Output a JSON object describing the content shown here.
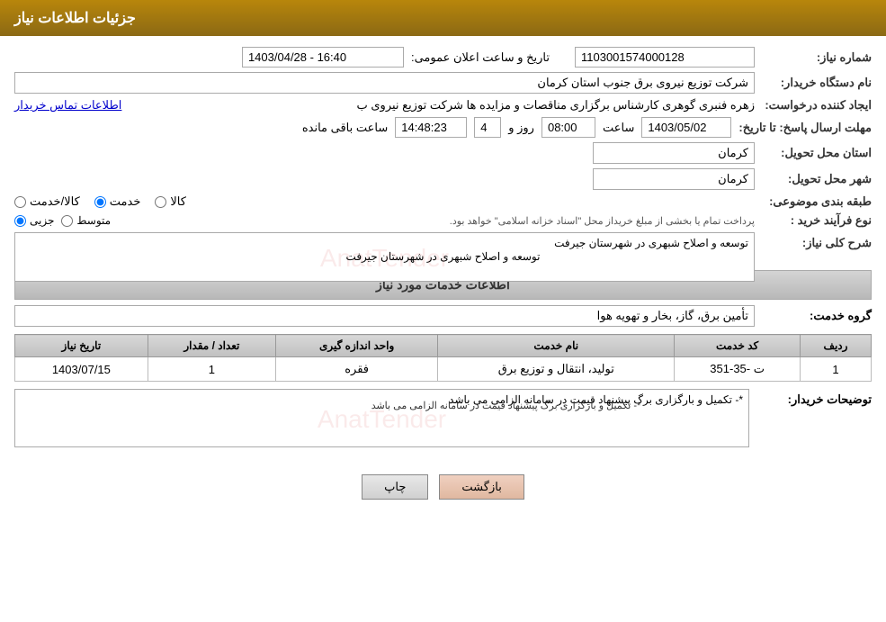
{
  "header": {
    "title": "جزئیات اطلاعات نیاز"
  },
  "fields": {
    "shomareNiaz_label": "شماره نیاز:",
    "shomareNiaz_value": "1103001574000128",
    "namDastgah_label": "نام دستگاه خریدار:",
    "namDastgah_value": "شرکت توزیع نیروی برق جنوب استان کرمان",
    "tarikhoSaat_label": "تاریخ و ساعت اعلان عمومی:",
    "tarikhoSaat_value": "1403/04/28 - 16:40",
    "ijadKonande_label": "ایجاد کننده درخواست:",
    "ijadKonande_value": "زهره فنبری گوهری کارشناس برگزاری مناقصات و مزایده ها شرکت توزیع نیروی ب",
    "ijadKonande_link": "اطلاعات تماس خریدار",
    "mohlatErsalPasokh_label": "مهلت ارسال پاسخ: تا تاریخ:",
    "mohlatDate": "1403/05/02",
    "mohlatSaat_label": "ساعت",
    "mohlatSaat": "08:00",
    "mohlatRooz_label": "روز و",
    "mohlatRooz": "4",
    "mohlatManande_label": "ساعت باقی مانده",
    "mohlatManande": "14:48:23",
    "ostan_label": "استان محل تحویل:",
    "ostan_value": "کرمان",
    "shahr_label": "شهر محل تحویل:",
    "shahr_value": "کرمان",
    "tabaghe_label": "طبقه بندی موضوعی:",
    "tabaghe_kala": "کالا",
    "tabaghe_khadamat": "خدمت",
    "tabaghe_kala_khadamat": "کالا/خدمت",
    "tabaghe_selected": "khadamat",
    "noeFarayand_label": "نوع فرآیند خرید :",
    "noeFarayand_jozvi": "جزیی",
    "noeFarayand_motevaset": "متوسط",
    "noeFarayand_text": "پرداخت تمام یا بخشی از مبلغ خریداز محل \"اسناد خزانه اسلامی\" خواهد بود.",
    "noeFarayand_selected": "jozvi",
    "sharh_label": "شرح کلی نیاز:",
    "sharh_value": "توسعه و اصلاح شبهری در شهرستان جیرفت",
    "service_section_title": "اطلاعات خدمات مورد نیاز",
    "groheKhadamat_label": "گروه خدمت:",
    "groheKhadamat_value": "تأمین برق، گاز، بخار و تهویه هوا",
    "table_headers": [
      "ردیف",
      "کد خدمت",
      "نام خدمت",
      "واحد اندازه گیری",
      "تعداد / مقدار",
      "تاریخ نیاز"
    ],
    "table_rows": [
      {
        "radif": "1",
        "kodKhadamat": "ت -35-351",
        "namKhadamat": "تولید، انتقال و توزیع برق",
        "vahed": "فقره",
        "tedad": "1",
        "tarikheNiaz": "1403/07/15"
      }
    ],
    "tavazihat_label": "توضیحات خریدار:",
    "tavazihat_value": "*- تکمیل و بارگزاری برگ پیشنهاد قیمت در سامانه الزامی می باشد",
    "btn_print": "چاپ",
    "btn_back": "بازگشت"
  }
}
